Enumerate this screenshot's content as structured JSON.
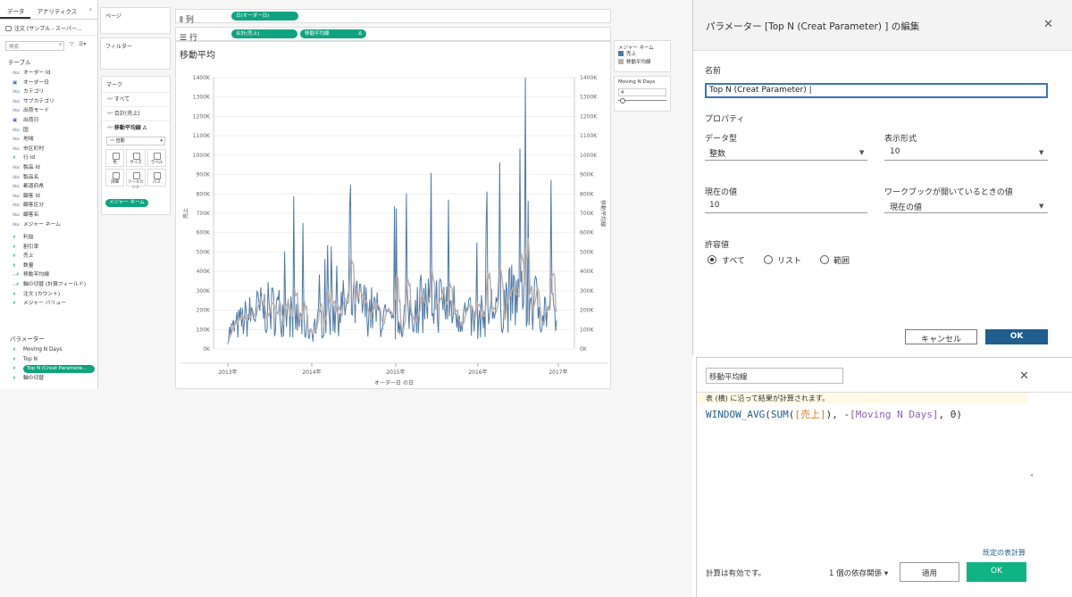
{
  "datapane": {
    "tabs": [
      "データ",
      "アナリティクス"
    ],
    "collapse": "‹",
    "datasource": "注文 (サンプル - スーパー...",
    "search_placeholder": "検索",
    "tables_title": "テーブル",
    "dimensions": [
      {
        "icon": "Abc",
        "label": "オーダー Id"
      },
      {
        "icon": "date",
        "label": "オーダー日"
      },
      {
        "icon": "Abc",
        "label": "カテゴリ"
      },
      {
        "icon": "Abc",
        "label": "サブカテゴリ"
      },
      {
        "icon": "Abc",
        "label": "出荷モード"
      },
      {
        "icon": "date",
        "label": "出荷日"
      },
      {
        "icon": "Abc",
        "label": "国"
      },
      {
        "icon": "Abc",
        "label": "地域"
      },
      {
        "icon": "Abc",
        "label": "市区町村"
      },
      {
        "icon": "num",
        "label": "行 Id"
      },
      {
        "icon": "Abc",
        "label": "製品 Id"
      },
      {
        "icon": "Abc",
        "label": "製品名"
      },
      {
        "icon": "Abc",
        "label": "都道府県"
      },
      {
        "icon": "Abc",
        "label": "顧客 Id"
      },
      {
        "icon": "Abc",
        "label": "顧客区分"
      },
      {
        "icon": "Abc",
        "label": "顧客名"
      },
      {
        "icon": "Abc",
        "label": "メジャー ネーム"
      }
    ],
    "measures": [
      {
        "icon": "num",
        "label": "利益"
      },
      {
        "icon": "num",
        "label": "割引率"
      },
      {
        "icon": "num",
        "label": "売上"
      },
      {
        "icon": "num",
        "label": "数量"
      },
      {
        "icon": "calc",
        "label": "移動平均線"
      },
      {
        "icon": "calc",
        "label": "軸の切替 (計算フィールド)"
      },
      {
        "icon": "num",
        "label": "注文 (カウント)"
      },
      {
        "icon": "num",
        "label": "メジャー バリュー"
      }
    ],
    "params_title": "パラメーター",
    "params": [
      "Moving N Days",
      "Top N",
      "Top N (Creat Paramete...",
      "軸の切替"
    ],
    "selected_param_index": 2
  },
  "shelves": {
    "pages": "ページ",
    "filters": "フィルター",
    "columns_label": "列",
    "rows_label": "行",
    "column_pill": "日(オーダー日)",
    "row_pills": [
      "合計(売上)",
      "移動平均線"
    ],
    "row_pill_delta": "Δ"
  },
  "marks": {
    "title": "マーク",
    "rows": [
      "すべて",
      "合計(売上)",
      "移動平均線"
    ],
    "row_delta": "Δ",
    "type": "自動",
    "buttons": [
      "色",
      "サイズ",
      "ラベル",
      "詳細",
      "ツールヒント",
      "パス"
    ],
    "pill": "メジャー ネーム"
  },
  "legend": {
    "title": "メジャー ネーム",
    "items": [
      {
        "label": "売上",
        "color": "#4e79a7"
      },
      {
        "label": "移動平均線",
        "color": "#bab0ac"
      }
    ]
  },
  "param_card": {
    "title": "Moving N Days",
    "value": "4"
  },
  "chart_data": {
    "type": "line",
    "title": "移動平均",
    "xlabel": "オーダー日 の日",
    "ylabel": "売上",
    "y2label": "移動平均線",
    "x_ticks": [
      "2013年",
      "2014年",
      "2015年",
      "2016年",
      "2017年"
    ],
    "ylim": [
      0,
      1400000
    ],
    "y_ticks": [
      "0K",
      "100K",
      "200K",
      "300K",
      "400K",
      "500K",
      "600K",
      "700K",
      "800K",
      "900K",
      "1000K",
      "1100K",
      "1200K",
      "1300K",
      "1400K"
    ],
    "series": [
      {
        "name": "売上",
        "color": "#4e79a7"
      },
      {
        "name": "移動平均線",
        "color": "#bab0ac"
      }
    ]
  },
  "param_dialog": {
    "title": "パラメーター [Top N (Creat Parameter) ] の編集",
    "name_label": "名前",
    "name_value": "Top N (Creat Parameter)",
    "properties_label": "プロパティ",
    "datatype_label": "データ型",
    "datatype_value": "整数",
    "display_format_label": "表示形式",
    "display_format_value": "10",
    "current_value_label": "現在の値",
    "current_value": "10",
    "workbook_open_label": "ワークブックが開いているときの値",
    "workbook_open_value": "現在の値",
    "allowable_label": "許容値",
    "allowable_options": [
      "すべて",
      "リスト",
      "範囲"
    ],
    "allowable_selected": 0,
    "cancel": "キャンセル",
    "ok": "OK"
  },
  "calc_editor": {
    "name": "移動平均線",
    "info": "表 (横) に沿って結果が計算されます。",
    "formula": {
      "fn1": "WINDOW_AVG",
      "p1": "(",
      "fn2": "SUM",
      "p2": "(",
      "field": "[売上]",
      "p3": "), -",
      "param": "[Moving N Days]",
      "p4": ", 0)"
    },
    "default_table_calc": "既定の表計算",
    "status": "計算は有効です。",
    "dependencies": "1 個の依存関係",
    "apply": "適用",
    "ok": "OK"
  }
}
